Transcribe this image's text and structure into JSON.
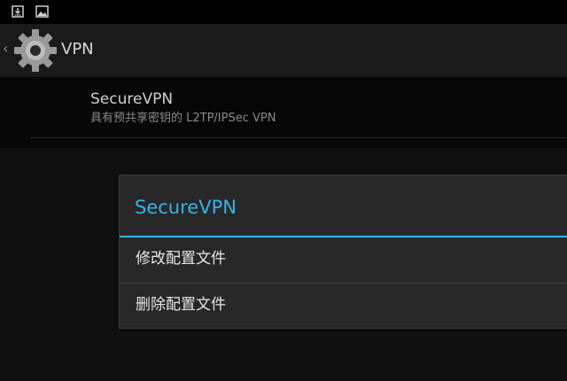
{
  "status_bar": {
    "icons": [
      "download-notification-icon",
      "image-notification-icon"
    ]
  },
  "action_bar": {
    "title": "VPN",
    "icon": "settings-gear-icon"
  },
  "vpn_list": {
    "items": [
      {
        "title": "SecureVPN",
        "summary": "具有预共享密钥的 L2TP/IPSec VPN"
      }
    ]
  },
  "dialog": {
    "title": "SecureVPN",
    "accent_color": "#33b5e5",
    "items": [
      {
        "label": "修改配置文件"
      },
      {
        "label": "删除配置文件"
      }
    ]
  }
}
